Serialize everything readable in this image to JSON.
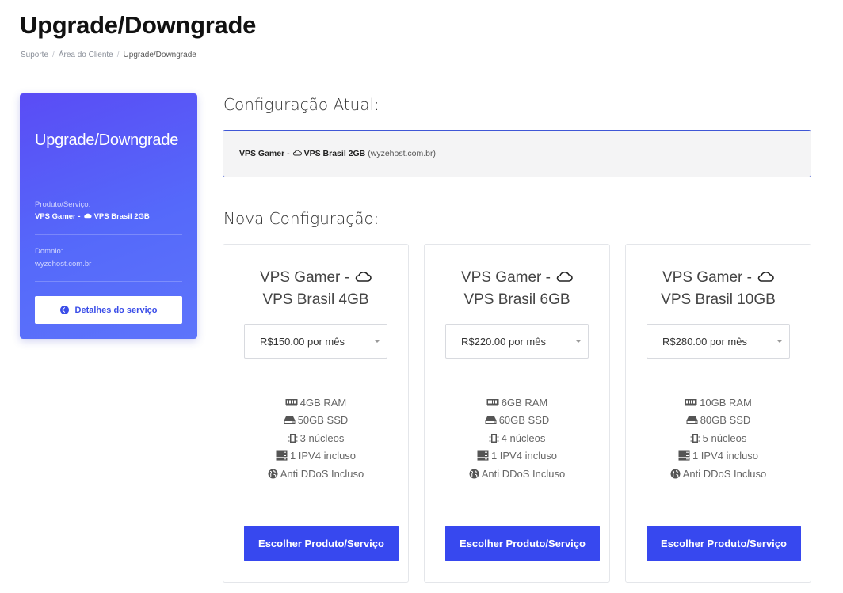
{
  "page": {
    "title": "Upgrade/Downgrade"
  },
  "breadcrumb": [
    {
      "label": "Suporte"
    },
    {
      "label": "Área do Cliente"
    },
    {
      "label": "Upgrade/Downgrade"
    }
  ],
  "sidebar": {
    "title": "Upgrade/Downgrade",
    "product_label": "Produto/Serviço:",
    "product_prefix": "VPS Gamer -",
    "product_name": "VPS Brasil 2GB",
    "domain_label": "Domnio:",
    "domain_value": "wyzehost.com.br",
    "details_button": "Detalhes do serviço"
  },
  "current": {
    "heading": "Configuração Atual:",
    "product_prefix": "VPS Gamer -",
    "product_name": "VPS Brasil 2GB",
    "domain": "(wyzehost.com.br)"
  },
  "new_config": {
    "heading": "Nova Configuração:",
    "plans": [
      {
        "title_line1": "VPS Gamer -",
        "title_line2": "VPS Brasil 4GB",
        "price": "R$150.00 por mês",
        "features": [
          {
            "icon": "ram-icon",
            "text": "4GB RAM"
          },
          {
            "icon": "disk-icon",
            "text": "50GB SSD"
          },
          {
            "icon": "cpu-icon",
            "text": "3 núcleos"
          },
          {
            "icon": "server-icon",
            "text": "1 IPV4 incluso"
          },
          {
            "icon": "globe-icon",
            "text": "Anti DDoS Incluso"
          }
        ],
        "button": "Escolher Produto/Serviço"
      },
      {
        "title_line1": "VPS Gamer -",
        "title_line2": "VPS Brasil 6GB",
        "price": "R$220.00 por mês",
        "features": [
          {
            "icon": "ram-icon",
            "text": "6GB RAM"
          },
          {
            "icon": "disk-icon",
            "text": "60GB SSD"
          },
          {
            "icon": "cpu-icon",
            "text": "4 núcleos"
          },
          {
            "icon": "server-icon",
            "text": "1 IPV4 incluso"
          },
          {
            "icon": "globe-icon",
            "text": "Anti DDoS Incluso"
          }
        ],
        "button": "Escolher Produto/Serviço"
      },
      {
        "title_line1": "VPS Gamer -",
        "title_line2": "VPS Brasil 10GB",
        "price": "R$280.00 por mês",
        "features": [
          {
            "icon": "ram-icon",
            "text": "10GB RAM"
          },
          {
            "icon": "disk-icon",
            "text": "80GB SSD"
          },
          {
            "icon": "cpu-icon",
            "text": "5 núcleos"
          },
          {
            "icon": "server-icon",
            "text": "1 IPV4 incluso"
          },
          {
            "icon": "globe-icon",
            "text": "Anti DDoS Incluso"
          }
        ],
        "button": "Escolher Produto/Serviço"
      }
    ]
  },
  "colors": {
    "accent": "#3748ef",
    "sidebar_gradient_start": "#5a4cf5",
    "sidebar_gradient_end": "#5d74fb",
    "current_border": "#3f57d6"
  }
}
